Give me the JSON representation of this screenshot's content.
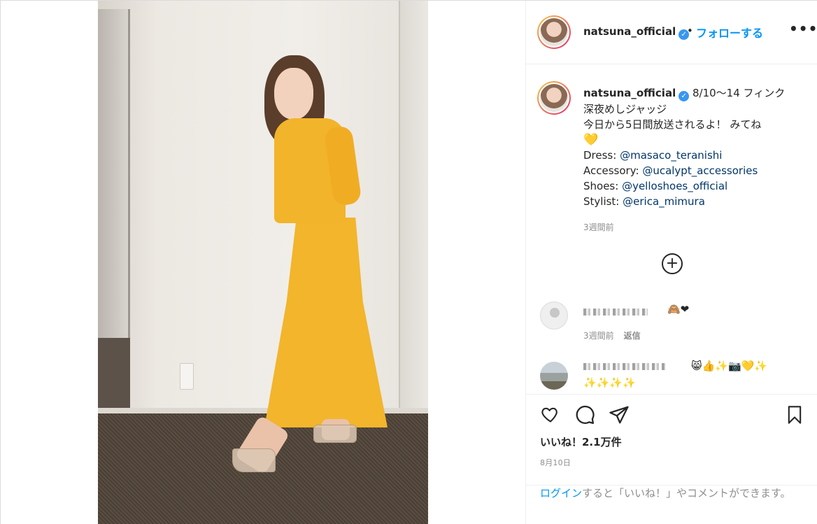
{
  "post": {
    "username": "natsuna_official",
    "verified_mark": "✓",
    "separator": "•",
    "follow_label": "フォローする",
    "more_label": "•••"
  },
  "caption": {
    "username": "natsuna_official",
    "line1": " 8/10〜14 フィンク",
    "line2": "深夜めしジャッジ",
    "line3": "今日から5日間放送されるよ！ みてね",
    "line4": "💛",
    "dress_prefix": "Dress: ",
    "dress_mention": "@masaco_teranishi",
    "accessory_prefix": "Accessory: ",
    "accessory_mention": "@ucalypt_accessories",
    "shoes_prefix": "Shoes: ",
    "shoes_mention": "@yelloshoes_official",
    "stylist_prefix": "Stylist: ",
    "stylist_mention": "@erica_mimura",
    "time": "3週間前",
    "load_more_label": "+"
  },
  "comments": [
    {
      "text": "🙈❤",
      "time": "3週間前",
      "reply": "返信"
    },
    {
      "text_line1": "😸👍✨📷💛✨",
      "text_line2": "✨✨✨✨"
    }
  ],
  "actions": {
    "likes": "いいね！2.1万件",
    "date": "8月10日"
  },
  "login": {
    "link": "ログイン",
    "rest": "すると「いいね！」やコメントができます。"
  },
  "colors": {
    "accent": "#0095f6",
    "mention": "#00376b",
    "muted": "#8e8e8e"
  }
}
